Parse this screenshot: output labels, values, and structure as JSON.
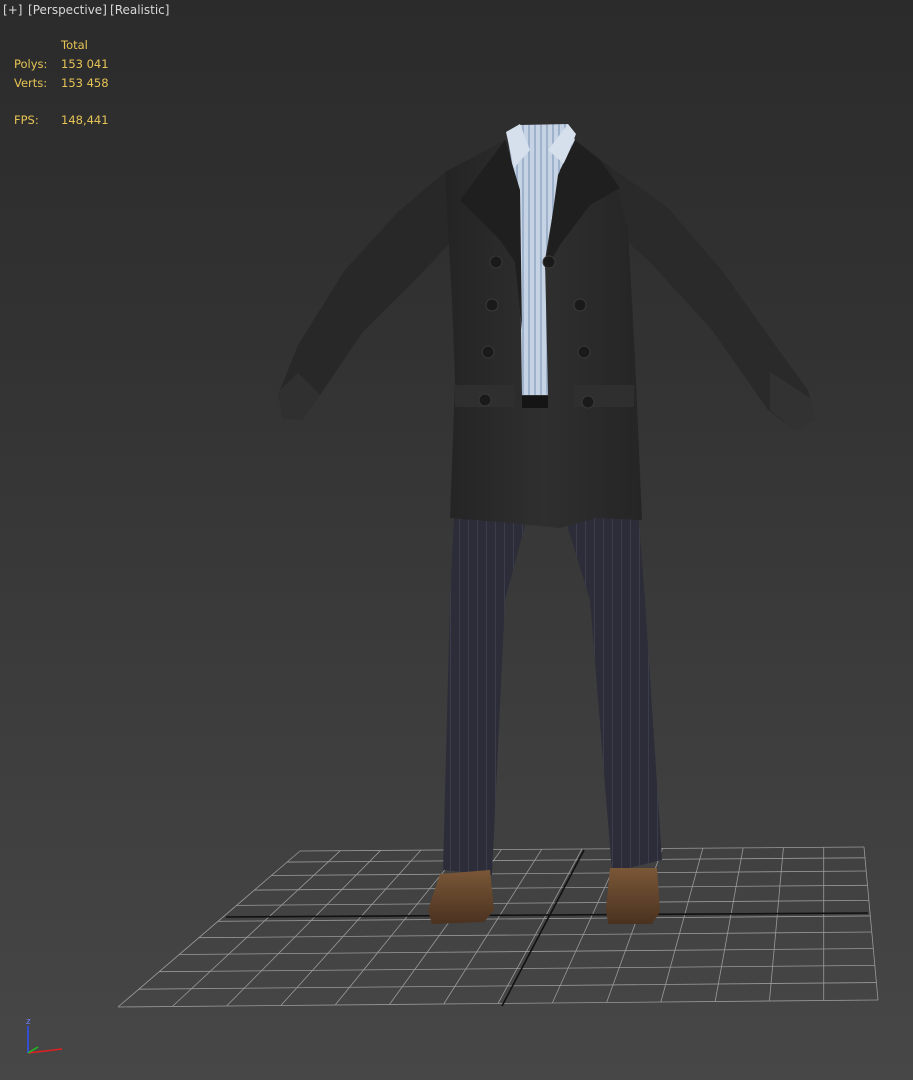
{
  "viewport": {
    "menus": [
      {
        "label": "+"
      },
      {
        "label": "Perspective"
      },
      {
        "label": "Realistic"
      }
    ]
  },
  "stats": {
    "header": "Total",
    "polys_label": "Polys:",
    "polys_value": "153 041",
    "verts_label": "Verts:",
    "verts_value": "153 458",
    "fps_label": "FPS:",
    "fps_value": "148,441"
  },
  "gizmo": {
    "axis_label": "z",
    "colors": {
      "x": "#e02020",
      "y": "#20c020",
      "z": "#3050ff"
    }
  },
  "model": {
    "icons": [
      "grid-icon",
      "character-model"
    ],
    "colors": {
      "coat": "#2a2a2a",
      "shirt": "#c3d1e2",
      "trousers": "#2c2d38",
      "shoes": "#6a4a2e",
      "grid": "#9a9a9a"
    }
  }
}
